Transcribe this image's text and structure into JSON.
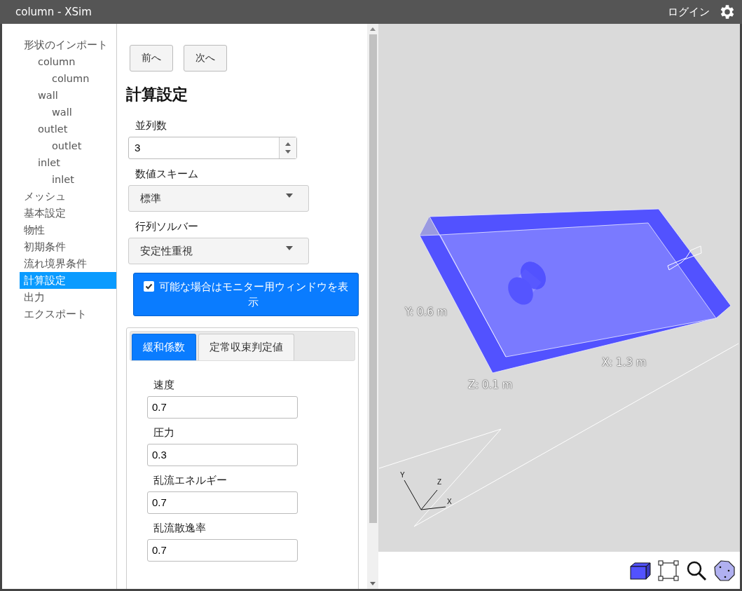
{
  "window": {
    "title": "column - XSim",
    "login": "ログイン"
  },
  "sidebar": {
    "items": [
      {
        "label": "形状のインポート",
        "selected": false,
        "children": [
          {
            "label": "column",
            "selected": false,
            "children": [
              {
                "label": "column",
                "selected": false
              }
            ]
          },
          {
            "label": "wall",
            "selected": false,
            "children": [
              {
                "label": "wall",
                "selected": false
              }
            ]
          },
          {
            "label": "outlet",
            "selected": false,
            "children": [
              {
                "label": "outlet",
                "selected": false
              }
            ]
          },
          {
            "label": "inlet",
            "selected": false,
            "children": [
              {
                "label": "inlet",
                "selected": false
              }
            ]
          }
        ]
      },
      {
        "label": "メッシュ",
        "selected": false
      },
      {
        "label": "基本設定",
        "selected": false
      },
      {
        "label": "物性",
        "selected": false
      },
      {
        "label": "初期条件",
        "selected": false
      },
      {
        "label": "流れ境界条件",
        "selected": false
      },
      {
        "label": "計算設定",
        "selected": true
      },
      {
        "label": "出力",
        "selected": false
      },
      {
        "label": "エクスポート",
        "selected": false
      }
    ]
  },
  "nav_buttons": [
    "前へ",
    "次へ"
  ],
  "heading": "計算設定",
  "fields": [
    {
      "kind": "number",
      "label": "並列数",
      "value": "3"
    },
    {
      "kind": "select",
      "label": "数値スキーム",
      "value": "標準"
    },
    {
      "kind": "select",
      "label": "行列ソルバー",
      "value": "安定性重視"
    }
  ],
  "monitor_toggle": {
    "label": "可能な場合はモニター用ウィンドウを表示",
    "checked": true
  },
  "tabs": [
    {
      "label": "緩和係数",
      "selected": true
    },
    {
      "label": "定常収束判定値",
      "selected": false
    }
  ],
  "tab_fields": [
    {
      "label": "速度",
      "value": "0.7"
    },
    {
      "label": "圧力",
      "value": "0.3"
    },
    {
      "label": "乱流エネルギー",
      "value": "0.7"
    },
    {
      "label": "乱流散逸率",
      "value": "0.7"
    }
  ],
  "viewer": {
    "dimension_labels": [
      "Y: 0.6 m",
      "X: 1.3 m",
      "Z: 0.1 m"
    ],
    "axis_labels": [
      "Y",
      "Z",
      "X"
    ]
  }
}
